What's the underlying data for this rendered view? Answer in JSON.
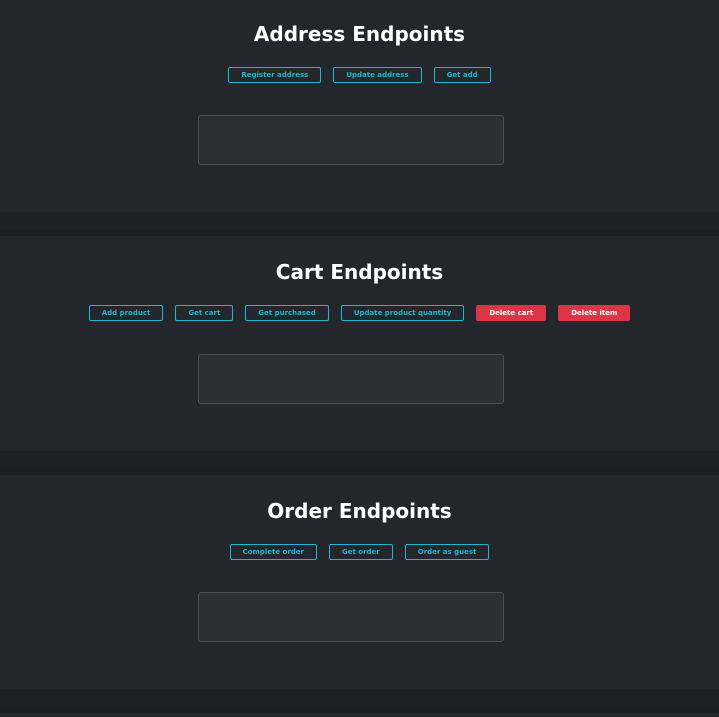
{
  "address": {
    "title": "Address Endpoints",
    "buttons": [
      "Register address",
      "Update address",
      "Get add"
    ]
  },
  "cart": {
    "title": "Cart Endpoints",
    "buttons": [
      "Add product",
      "Get cart",
      "Get purchased",
      "Update product quantity"
    ],
    "danger_buttons": [
      "Delete cart",
      "Delete item"
    ]
  },
  "order": {
    "title": "Order Endpoints",
    "buttons": [
      "Complete order",
      "Get order",
      "Order as guest"
    ]
  },
  "colors": {
    "background": "#1d2024",
    "section": "#23262b",
    "accent": "#1fb5d4",
    "danger": "#dc3545",
    "output": "#2c3035"
  }
}
